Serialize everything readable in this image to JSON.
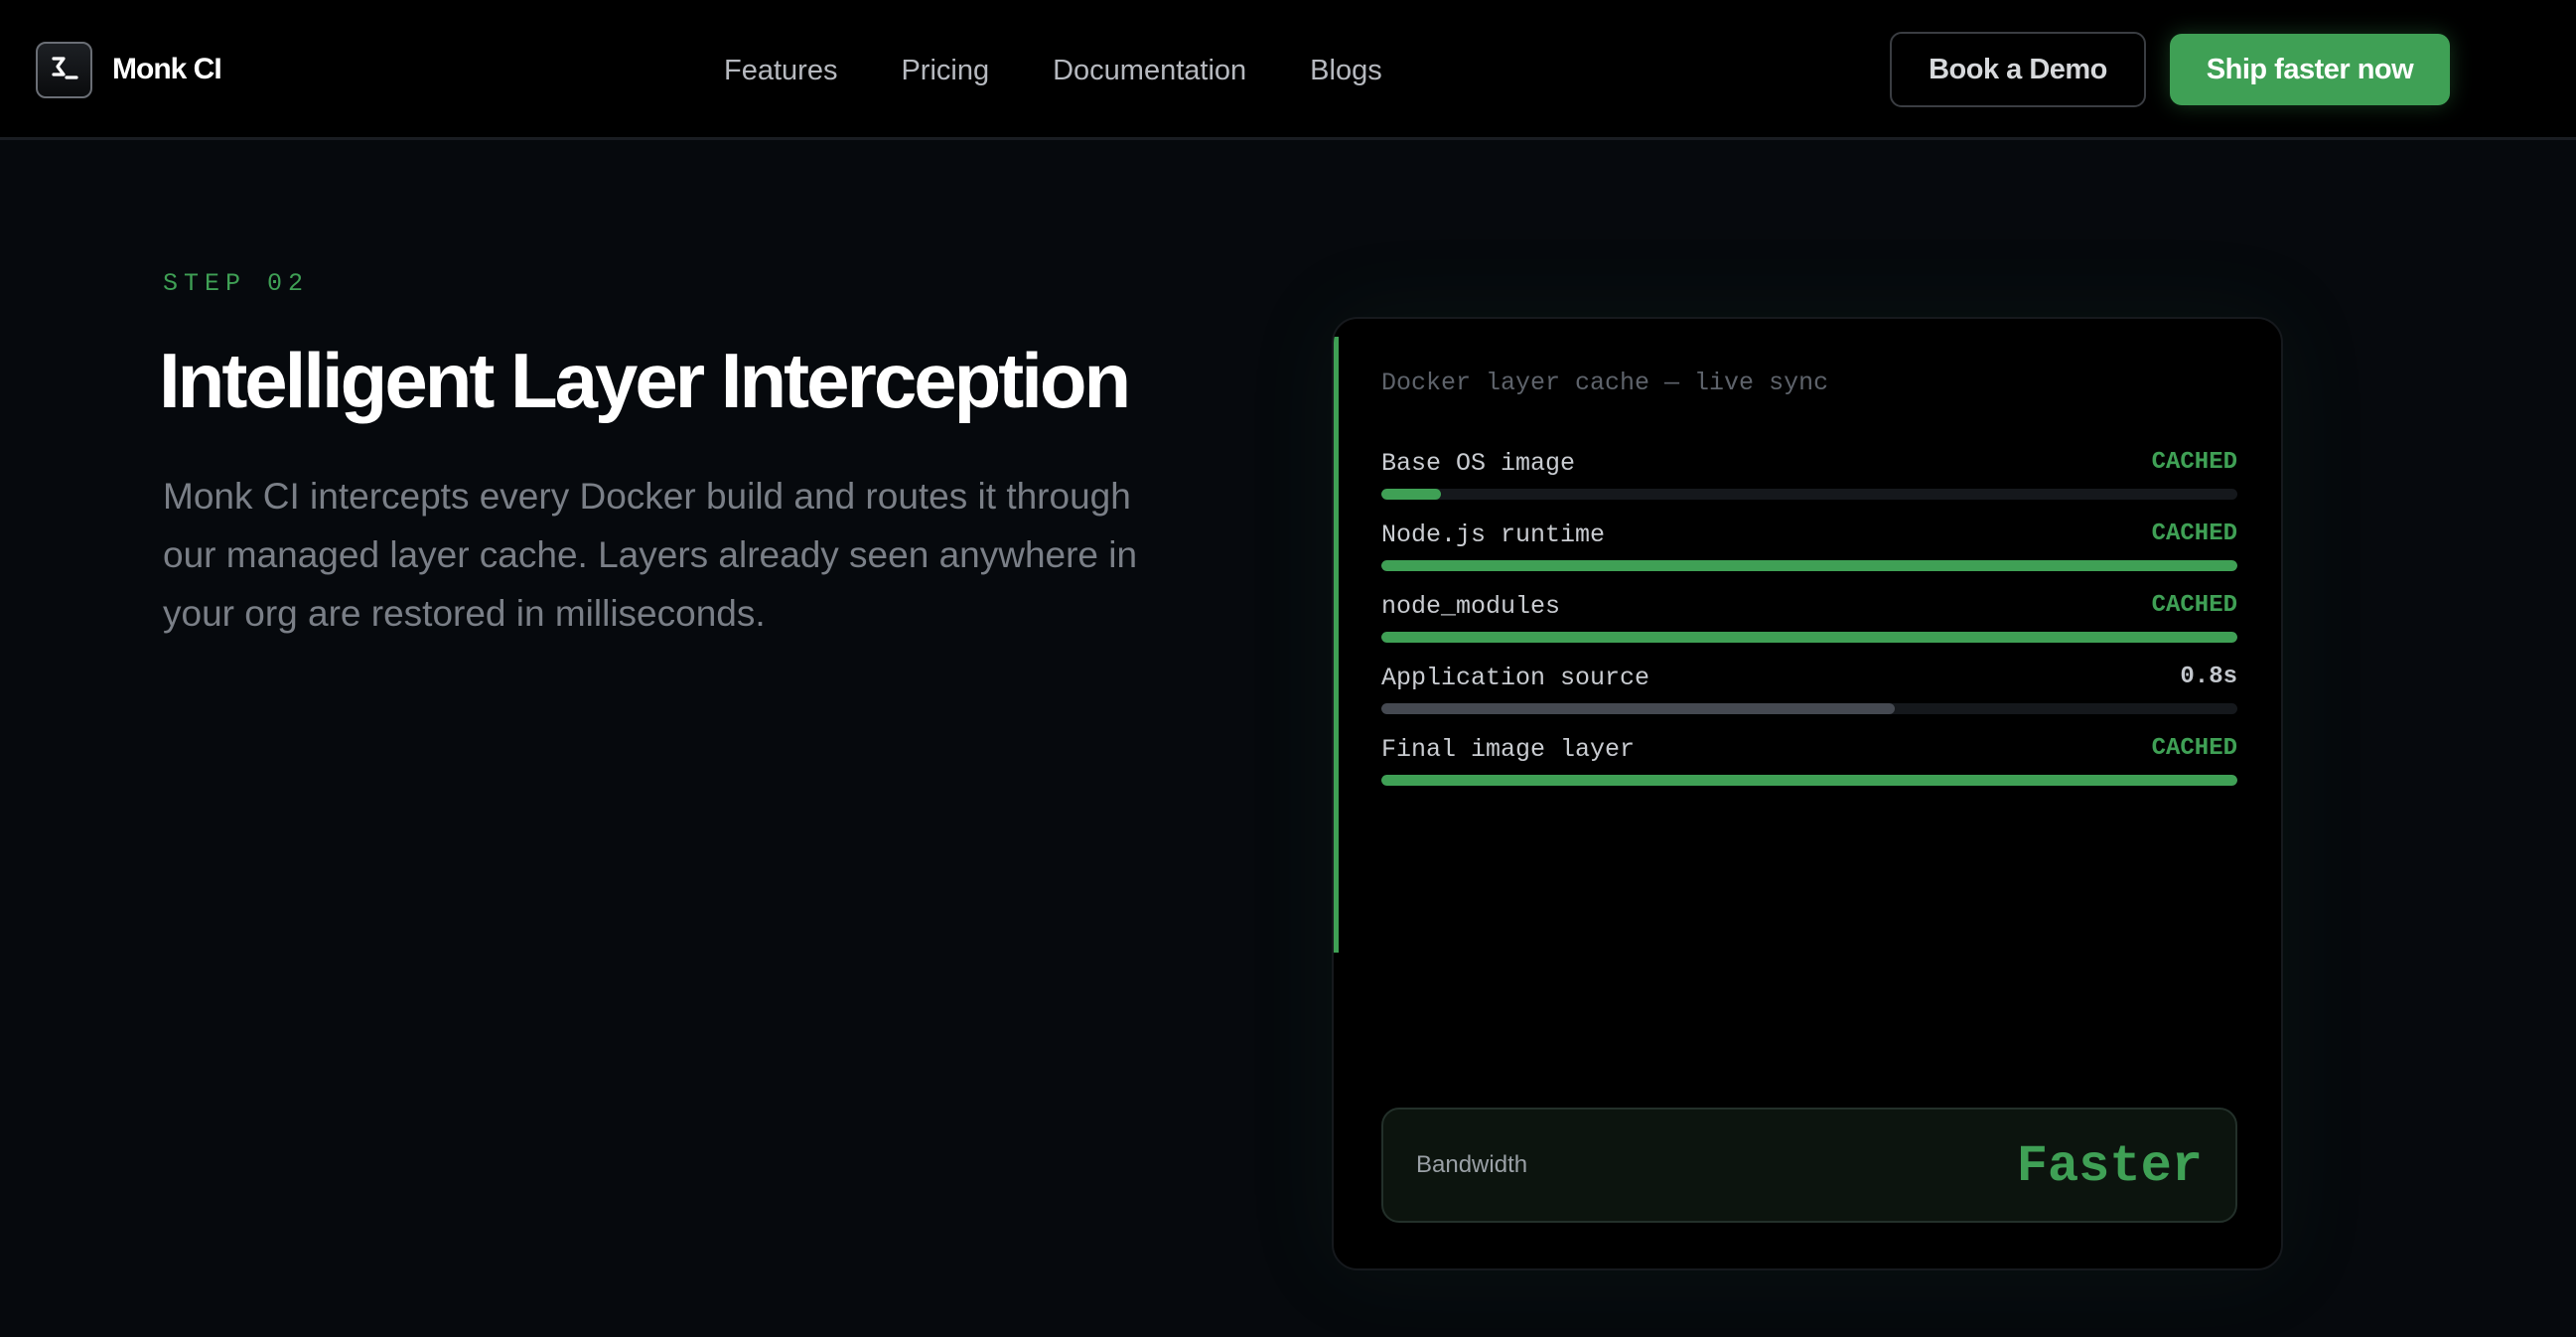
{
  "brand": {
    "name": "Monk CI",
    "logo_icon": "terminal-sigma-icon"
  },
  "nav": {
    "links": [
      "Features",
      "Pricing",
      "Documentation",
      "Blogs"
    ],
    "book_demo": "Book a Demo",
    "cta": "Ship faster now"
  },
  "hero": {
    "step": "STEP 02",
    "title": "Intelligent Layer Interception",
    "description": "Monk CI intercepts every Docker build and routes it through our managed layer cache. Layers already seen anywhere in your org are restored in milliseconds."
  },
  "cache_card": {
    "header": "Docker layer cache — live sync",
    "layers": [
      {
        "name": "Base OS image",
        "status": "CACHED",
        "progress": 0.07,
        "bar_color": "#3fa055",
        "status_color": "#3fa055"
      },
      {
        "name": "Node.js runtime",
        "status": "CACHED",
        "progress": 1.0,
        "bar_color": "#3fa055",
        "status_color": "#3fa055"
      },
      {
        "name": "node_modules",
        "status": "CACHED",
        "progress": 1.0,
        "bar_color": "#3fa055",
        "status_color": "#3fa055"
      },
      {
        "name": "Application source",
        "status": "0.8s",
        "progress": 0.6,
        "bar_color": "#454951",
        "status_color": "#c3c7cd"
      },
      {
        "name": "Final image layer",
        "status": "CACHED",
        "progress": 1.0,
        "bar_color": "#3fa055",
        "status_color": "#3fa055"
      }
    ],
    "bandwidth": {
      "label": "Bandwidth",
      "value": "Faster"
    }
  },
  "colors": {
    "accent": "#3fa055",
    "background": "#06090d",
    "navbar": "#000000"
  }
}
